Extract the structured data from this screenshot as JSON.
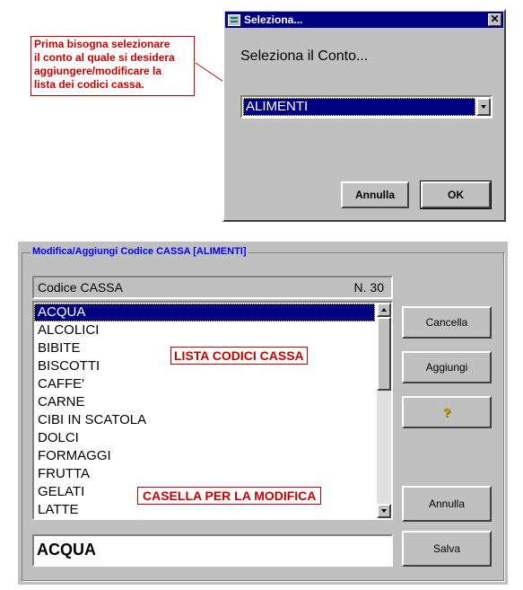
{
  "annotation_top": {
    "lines": [
      "Prima bisogna selezionare",
      "il conto al quale si desidera",
      "aggiungere/modificare la",
      "lista dei codici cassa."
    ]
  },
  "dialog": {
    "title": "Seleziona...",
    "prompt": "Seleziona il Conto...",
    "selected_account": "ALIMENTI",
    "cancel_label": "Annulla",
    "ok_label": "OK"
  },
  "form": {
    "group_title": "Modifica/Aggiungi Codice CASSA [ALIMENTI]",
    "header_label": "Codice CASSA",
    "count_label": "N. 30",
    "items": [
      "ACQUA",
      "ALCOLICI",
      "BIBITE",
      "BISCOTTI",
      "CAFFE'",
      "CARNE",
      "CIBI IN SCATOLA",
      "DOLCI",
      "FORMAGGI",
      "FRUTTA",
      "GELATI",
      "LATTE"
    ],
    "selected_index": 0,
    "edit_value": "ACQUA",
    "buttons": {
      "delete": "Cancella",
      "add": "Aggiungi",
      "help": "?",
      "cancel": "Annulla",
      "save": "Salva"
    },
    "list_callout": "LISTA CODICI CASSA",
    "edit_callout": "CASELLA PER LA MODIFICA"
  },
  "colors": {
    "title_bar": "#000080",
    "callout": "#cc0000",
    "group_title": "#0000ff",
    "face": "#c0c0c0"
  }
}
